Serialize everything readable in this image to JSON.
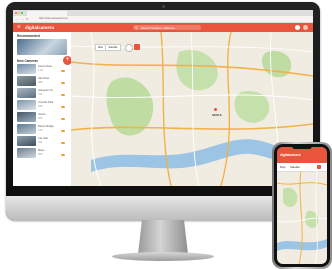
{
  "browser": {
    "url": "https://www.cameraurl.com"
  },
  "app": {
    "brand": "digitalcamera",
    "search_placeholder": "Search location, address...",
    "accent_color": "#e8543c"
  },
  "sidebar": {
    "recommended_label": "Recommended",
    "new_cams_label": "New Cameras",
    "cameras": [
      {
        "name": "Seoul Tower",
        "views": "1.2k"
      },
      {
        "name": "Han River",
        "views": "980"
      },
      {
        "name": "Gangnam St",
        "views": "760"
      },
      {
        "name": "Yeouido Park",
        "views": "640"
      },
      {
        "name": "Jamsil",
        "views": "520"
      },
      {
        "name": "Banpo Bridge",
        "views": "410"
      },
      {
        "name": "City Hall",
        "views": "390"
      },
      {
        "name": "Mapo",
        "views": "300"
      }
    ]
  },
  "map": {
    "tab_map": "Map",
    "tab_satellite": "Satellite",
    "city_label": "SEOUL"
  },
  "phone": {
    "brand": "digitalcamera",
    "tab_map": "Map",
    "tab_satellite": "Satellite"
  }
}
